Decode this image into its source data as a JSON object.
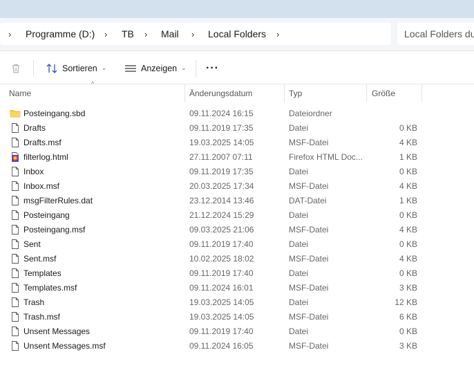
{
  "address": {
    "breadcrumbs": [
      "Programme (D:)",
      "TB",
      "Mail",
      "Local Folders"
    ],
    "search_placeholder": "Local Folders du"
  },
  "toolbar": {
    "sort_label": "Sortieren",
    "view_label": "Anzeigen",
    "more_label": "···"
  },
  "columns": {
    "name": "Name",
    "date": "Änderungsdatum",
    "type": "Typ",
    "size": "Größe"
  },
  "files": [
    {
      "name": "Posteingang.sbd",
      "date": "09.11.2024 16:15",
      "type": "Dateiordner",
      "size": "",
      "icon": "folder-icon"
    },
    {
      "name": "Drafts",
      "date": "09.11.2019 17:35",
      "type": "Datei",
      "size": "0 KB",
      "icon": "file-icon"
    },
    {
      "name": "Drafts.msf",
      "date": "19.03.2025 14:05",
      "type": "MSF-Datei",
      "size": "4 KB",
      "icon": "file-icon"
    },
    {
      "name": "filterlog.html",
      "date": "27.11.2007 07:11",
      "type": "Firefox HTML Doc...",
      "size": "1 KB",
      "icon": "firefox-html-icon"
    },
    {
      "name": "Inbox",
      "date": "09.11.2019 17:35",
      "type": "Datei",
      "size": "0 KB",
      "icon": "file-icon"
    },
    {
      "name": "Inbox.msf",
      "date": "20.03.2025 17:34",
      "type": "MSF-Datei",
      "size": "4 KB",
      "icon": "file-icon"
    },
    {
      "name": "msgFilterRules.dat",
      "date": "23.12.2014 13:46",
      "type": "DAT-Datei",
      "size": "1 KB",
      "icon": "file-icon"
    },
    {
      "name": "Posteingang",
      "date": "21.12.2024 15:29",
      "type": "Datei",
      "size": "0 KB",
      "icon": "file-icon"
    },
    {
      "name": "Posteingang.msf",
      "date": "09.03.2025 21:06",
      "type": "MSF-Datei",
      "size": "4 KB",
      "icon": "file-icon"
    },
    {
      "name": "Sent",
      "date": "09.11.2019 17:40",
      "type": "Datei",
      "size": "0 KB",
      "icon": "file-icon"
    },
    {
      "name": "Sent.msf",
      "date": "10.02.2025 18:02",
      "type": "MSF-Datei",
      "size": "4 KB",
      "icon": "file-icon"
    },
    {
      "name": "Templates",
      "date": "09.11.2019 17:40",
      "type": "Datei",
      "size": "0 KB",
      "icon": "file-icon"
    },
    {
      "name": "Templates.msf",
      "date": "09.11.2024 16:01",
      "type": "MSF-Datei",
      "size": "3 KB",
      "icon": "file-icon"
    },
    {
      "name": "Trash",
      "date": "19.03.2025 14:05",
      "type": "Datei",
      "size": "12 KB",
      "icon": "file-icon"
    },
    {
      "name": "Trash.msf",
      "date": "19.03.2025 14:05",
      "type": "MSF-Datei",
      "size": "6 KB",
      "icon": "file-icon"
    },
    {
      "name": "Unsent Messages",
      "date": "09.11.2019 17:40",
      "type": "Datei",
      "size": "0 KB",
      "icon": "file-icon"
    },
    {
      "name": "Unsent Messages.msf",
      "date": "09.11.2024 16:05",
      "type": "MSF-Datei",
      "size": "3 KB",
      "icon": "file-icon"
    }
  ],
  "colors": {
    "titlebar": "#d3e1ef",
    "folder": "#f8c93e",
    "firefox_html": "#7a2fb8"
  }
}
